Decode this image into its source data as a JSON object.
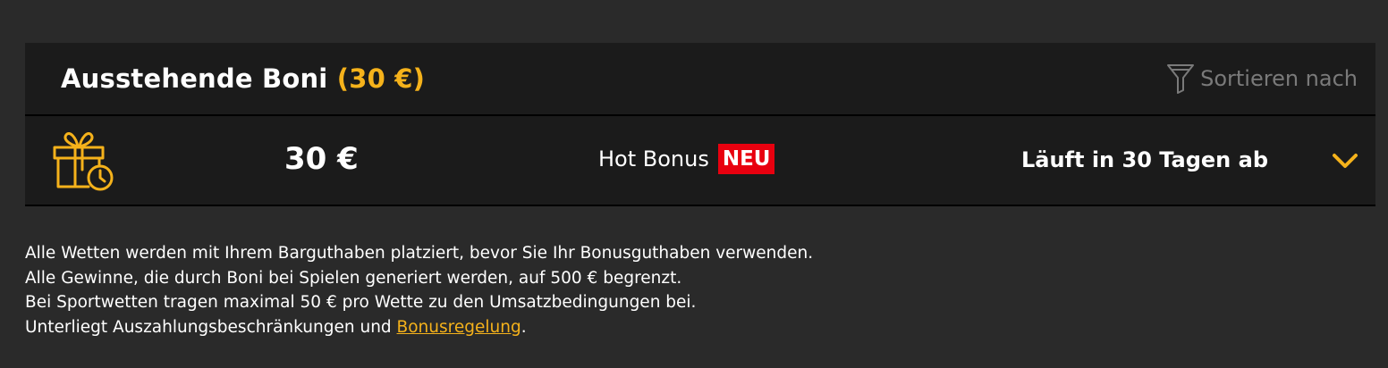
{
  "header": {
    "title": "Ausstehende Boni",
    "amount": "(30 €)",
    "sort_label": "Sortieren nach"
  },
  "bonus": {
    "amount": "30 €",
    "name": "Hot Bonus",
    "badge": "NEU",
    "expiry": "Läuft in 30 Tagen ab"
  },
  "notes": {
    "line1": "Alle Wetten werden mit Ihrem Barguthaben platziert, bevor Sie Ihr Bonusguthaben verwenden.",
    "line2": "Alle Gewinne, die durch Boni bei Spielen generiert werden, auf 500 € begrenzt.",
    "line3": "Bei Sportwetten tragen maximal 50 € pro Wette zu den Umsatzbedingungen bei.",
    "line4_prefix": "Unterliegt Auszahlungsbeschränkungen und ",
    "line4_link": "Bonusregelung",
    "line4_suffix": "."
  },
  "colors": {
    "accent": "#f5b21b",
    "badge_red": "#e8000f",
    "panel_bg": "#1b1b1b",
    "page_bg": "#2a2a2a"
  },
  "icons": {
    "gift": "gift-clock-icon",
    "sort": "filter-icon",
    "expand": "chevron-down-icon"
  }
}
